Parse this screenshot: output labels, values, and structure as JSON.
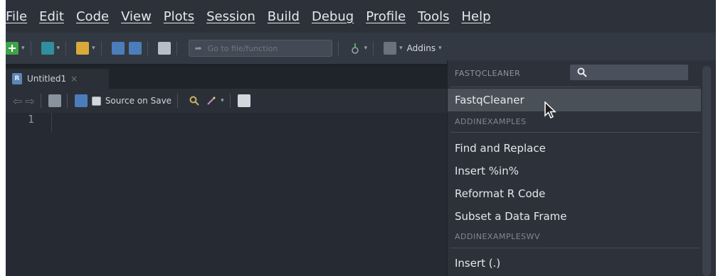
{
  "menubar": {
    "items": [
      "File",
      "Edit",
      "Code",
      "View",
      "Plots",
      "Session",
      "Build",
      "Debug",
      "Profile",
      "Tools",
      "Help"
    ]
  },
  "toolbar": {
    "goto_placeholder": "Go to file/function",
    "addins_label": "Addins"
  },
  "editor": {
    "tab_label": "Untitled1",
    "source_on_save": "Source on Save",
    "line_number": "1"
  },
  "dropdown": {
    "search_section": "FASTQCLEANER",
    "items": [
      {
        "label": "FastqCleaner",
        "active": true
      },
      {
        "group": "ADDINEXAMPLES"
      },
      {
        "label": "Find and Replace"
      },
      {
        "label": "Insert %in%"
      },
      {
        "label": "Reformat R Code"
      },
      {
        "label": "Subset a Data Frame"
      },
      {
        "group": "ADDINEXAMPLESWV"
      },
      {
        "label": "Insert (.)"
      }
    ]
  },
  "colors": {
    "background": "#262b33",
    "menubar": "#2d323a",
    "active_item": "#4a5058"
  }
}
